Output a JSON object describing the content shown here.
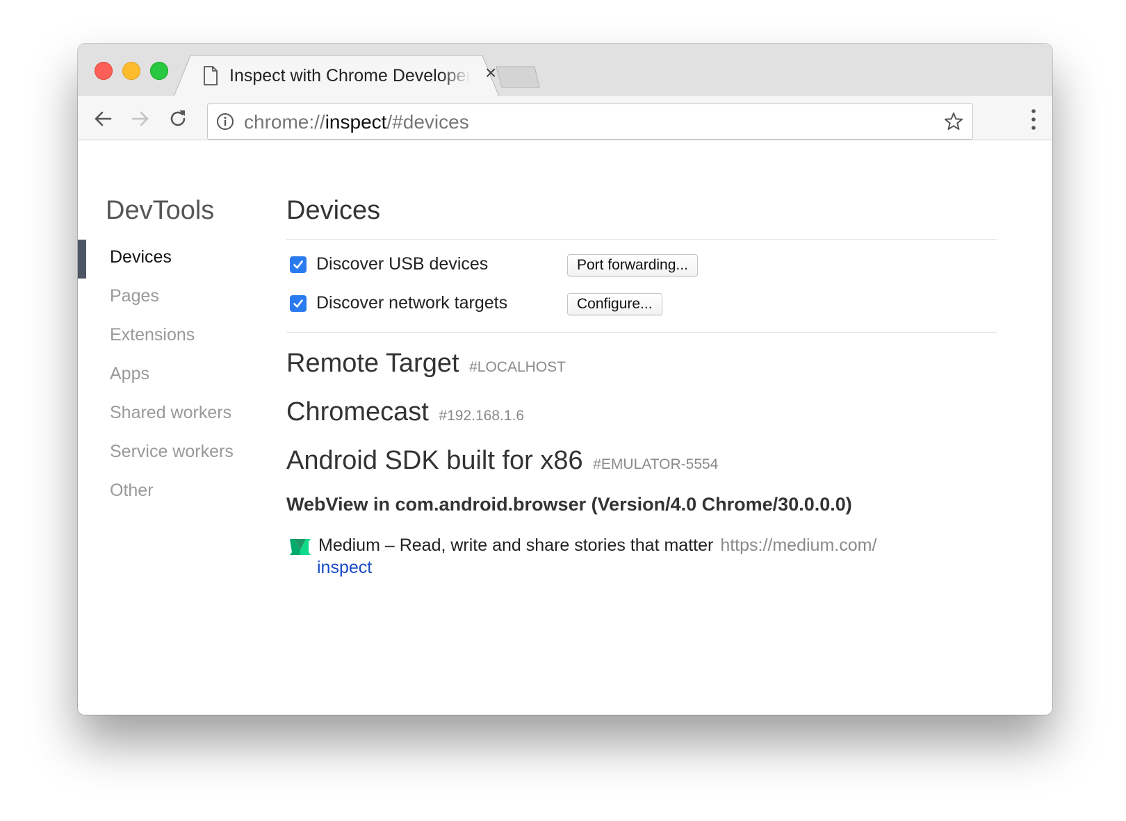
{
  "tab": {
    "title": "Inspect with Chrome Developer Tools",
    "close": "×"
  },
  "address_bar": {
    "scheme": "chrome://",
    "host": "inspect",
    "path": "/#devices"
  },
  "sidebar": {
    "brand": "DevTools",
    "items": [
      {
        "label": "Devices",
        "active": true
      },
      {
        "label": "Pages",
        "active": false
      },
      {
        "label": "Extensions",
        "active": false
      },
      {
        "label": "Apps",
        "active": false
      },
      {
        "label": "Shared workers",
        "active": false
      },
      {
        "label": "Service workers",
        "active": false
      },
      {
        "label": "Other",
        "active": false
      }
    ]
  },
  "main": {
    "heading": "Devices",
    "options": [
      {
        "label": "Discover USB devices",
        "checked": true,
        "button": "Port forwarding..."
      },
      {
        "label": "Discover network targets",
        "checked": true,
        "button": "Configure..."
      }
    ],
    "devices": [
      {
        "name": "Remote Target",
        "serial": "#LOCALHOST"
      },
      {
        "name": "Chromecast",
        "serial": "#192.168.1.6"
      },
      {
        "name": "Android SDK built for x86",
        "serial": "#EMULATOR-5554"
      }
    ],
    "browser": "WebView in com.android.browser (Version/4.0 Chrome/30.0.0.0)",
    "page": {
      "title": "Medium – Read, write and share stories that matter",
      "url": "https://medium.com/",
      "action": "inspect",
      "icon": "medium-icon"
    }
  },
  "colors": {
    "accent": "#2b7bf0",
    "link": "#1a4ac8",
    "indicator": "#4e5665",
    "medium_green": "#00ab6c"
  }
}
